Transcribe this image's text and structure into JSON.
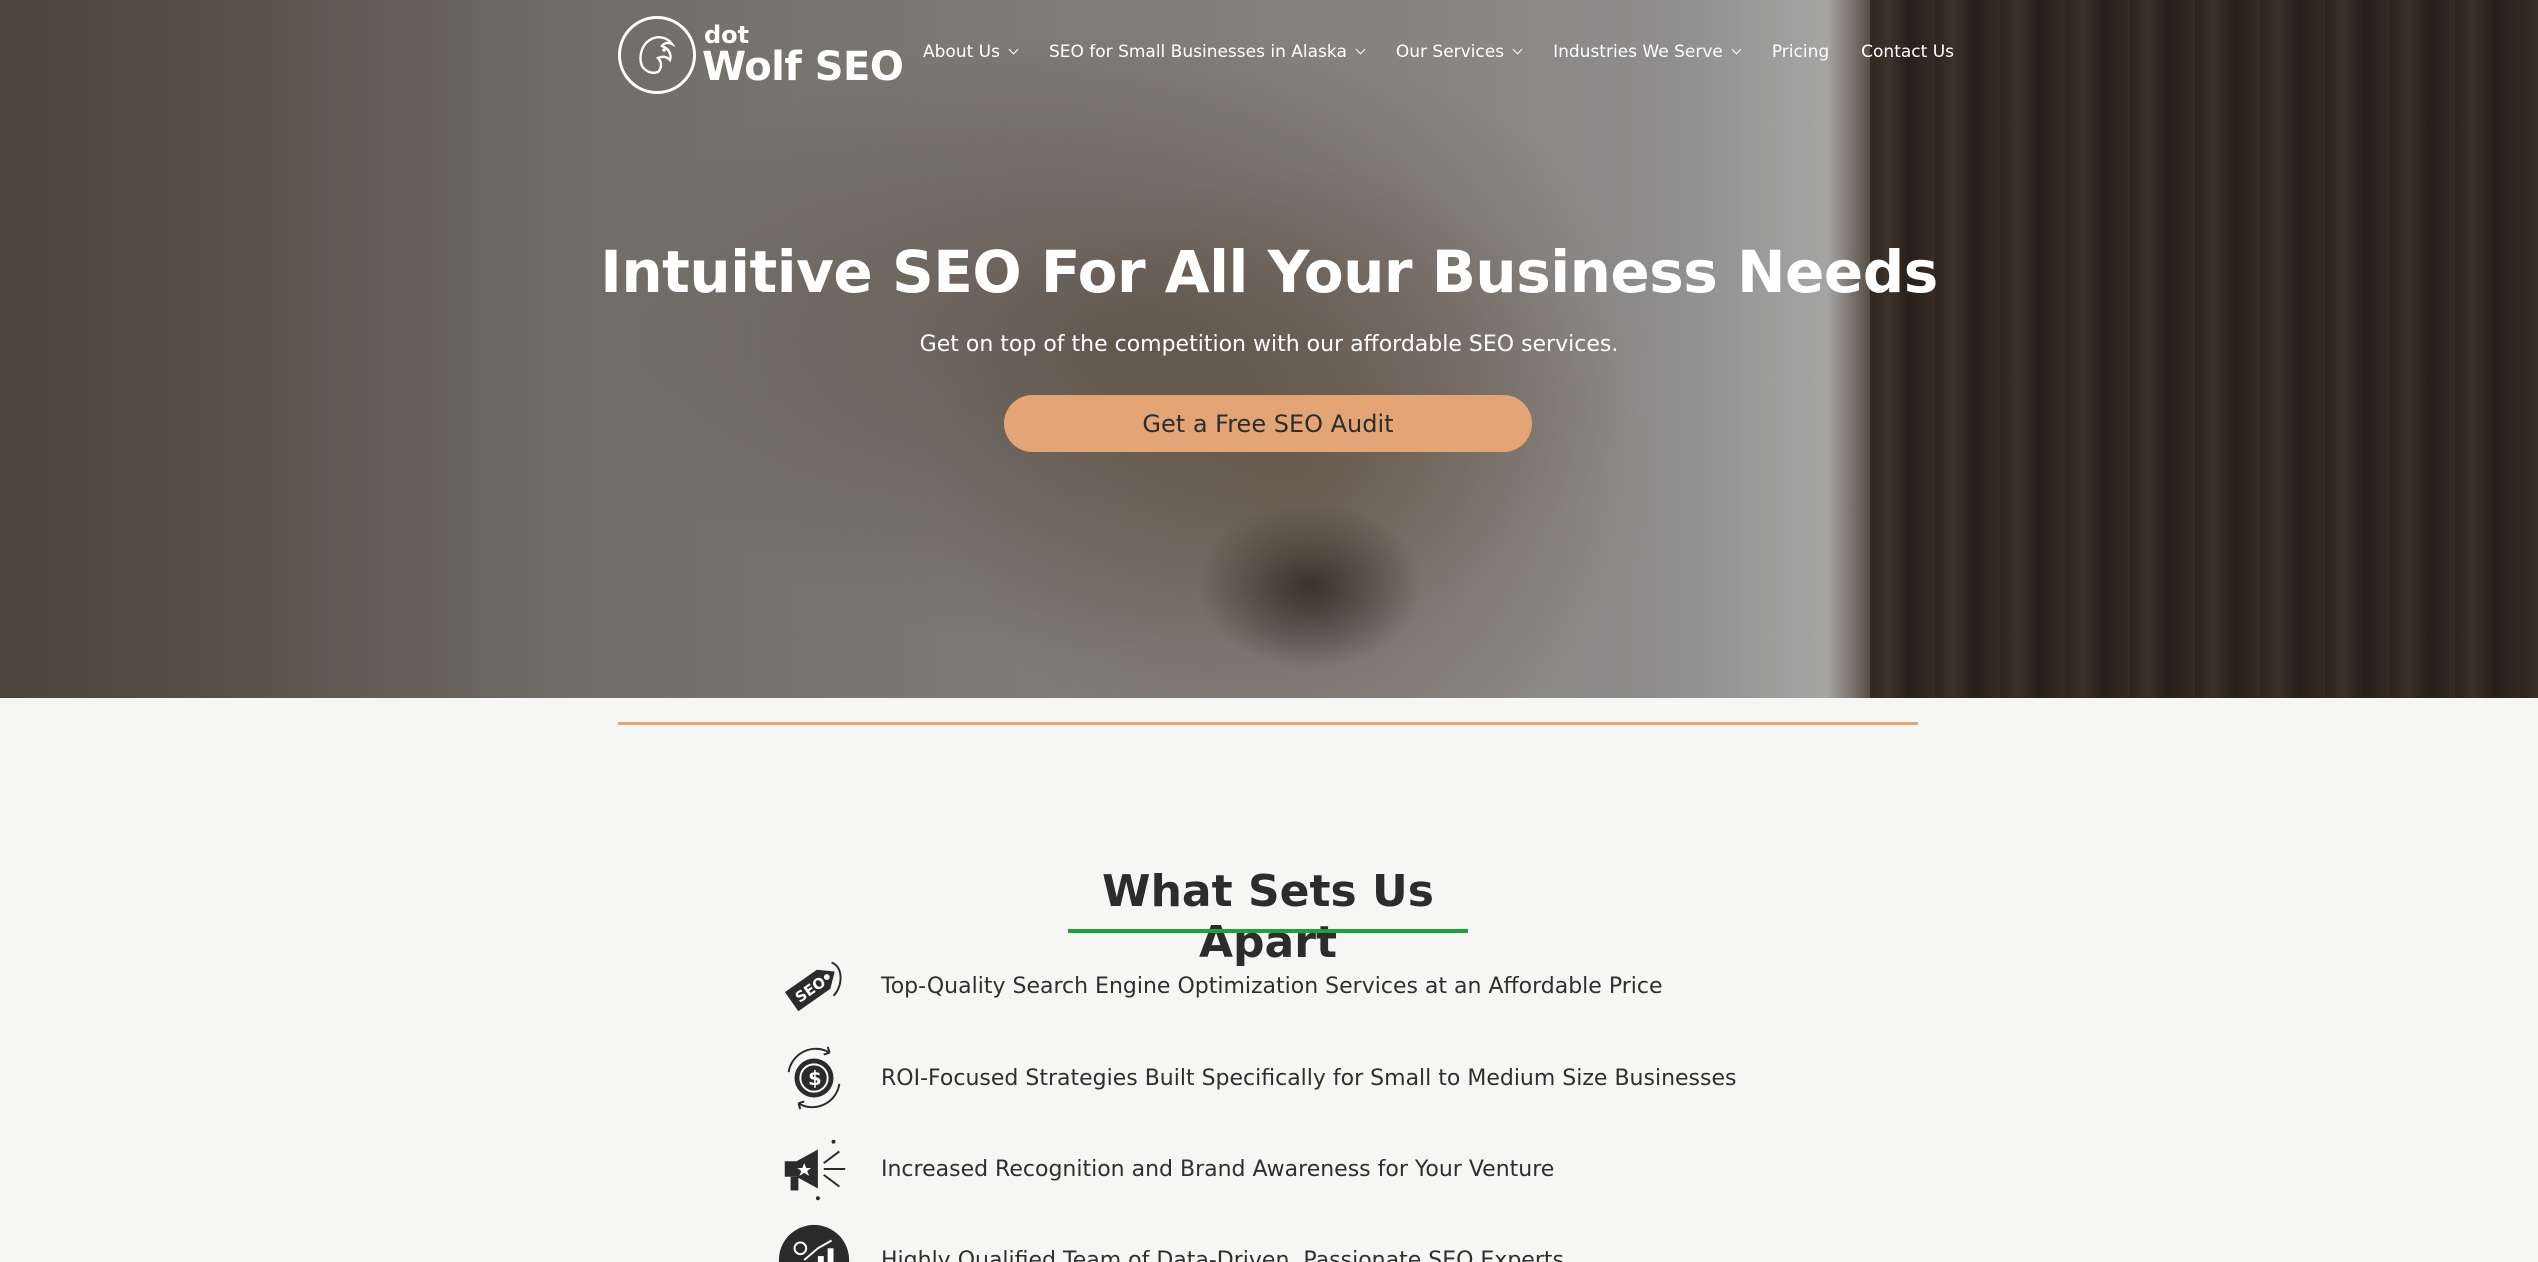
{
  "brand": {
    "dot": "dot",
    "name": "Wolf SEO",
    "logo_icon": "wolf-logo-icon"
  },
  "nav": [
    {
      "label": "About Us",
      "dropdown": true
    },
    {
      "label": "SEO for Small Businesses in Alaska",
      "dropdown": true
    },
    {
      "label": "Our Services",
      "dropdown": true
    },
    {
      "label": "Industries We Serve",
      "dropdown": true
    },
    {
      "label": "Pricing",
      "dropdown": false
    },
    {
      "label": "Contact Us",
      "dropdown": false
    }
  ],
  "hero": {
    "title": "Intuitive SEO For All Your Business Needs",
    "subtitle": "Get on top of the competition with our affordable SEO services.",
    "cta_label": "Get a Free SEO Audit"
  },
  "features": {
    "heading": "What Sets Us Apart",
    "items": [
      {
        "icon": "seo-tag-icon",
        "text": "Top-Quality Search Engine Optimization Services at an Affordable Price"
      },
      {
        "icon": "dollar-cycle-icon",
        "text": "ROI-Focused Strategies Built Specifically for Small to Medium Size Businesses"
      },
      {
        "icon": "megaphone-icon",
        "text": "Increased Recognition and Brand Awareness for Your Venture"
      },
      {
        "icon": "growth-chart-icon",
        "text": "Highly Qualified Team of Data-Driven, Passionate SEO Experts"
      }
    ]
  },
  "colors": {
    "accent": "#e3a575",
    "underline": "#1aa33a",
    "background": "#f6f7f5"
  }
}
